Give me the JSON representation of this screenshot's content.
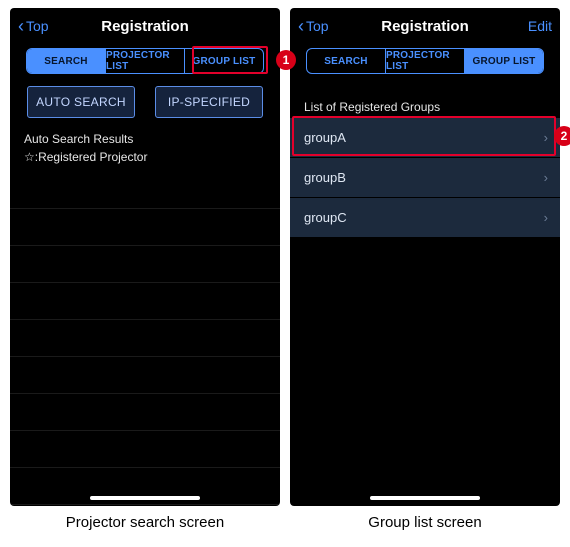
{
  "left": {
    "nav": {
      "back": "Top",
      "title": "Registration"
    },
    "segments": {
      "search": "SEARCH",
      "projector_list": "PROJECTOR LIST",
      "group_list": "GROUP LIST"
    },
    "buttons": {
      "auto_search": "AUTO SEARCH",
      "ip_specified": "IP-SPECIFIED"
    },
    "results_header_line1": "Auto Search Results",
    "results_header_line2": "☆:Registered Projector",
    "caption": "Projector search screen"
  },
  "right": {
    "nav": {
      "back": "Top",
      "title": "Registration",
      "edit": "Edit"
    },
    "segments": {
      "search": "SEARCH",
      "projector_list": "PROJECTOR LIST",
      "group_list": "GROUP LIST"
    },
    "section_header": "List of Registered Groups",
    "groups": {
      "a": "groupA",
      "b": "groupB",
      "c": "groupC"
    },
    "caption": "Group list screen"
  },
  "callouts": {
    "one": "1",
    "two": "2"
  }
}
